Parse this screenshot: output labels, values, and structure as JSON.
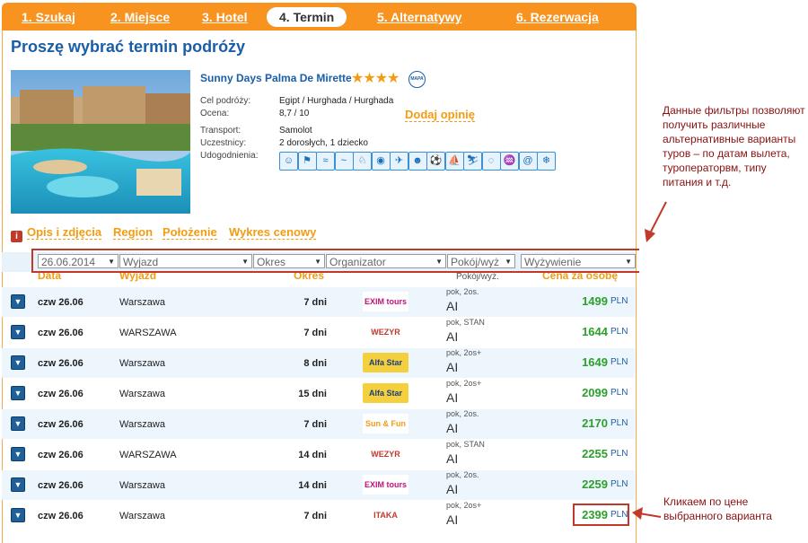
{
  "tabs": [
    "1. Szukaj",
    "2. Miejsce",
    "3. Hotel",
    "4. Termin",
    "5. Alternatywy",
    "6. Rezerwacja"
  ],
  "active_tab": 3,
  "page_title": "Proszę wybrać termin podróży",
  "hotel": {
    "name": "Sunny Days Palma De Mirette",
    "stars": "★★★★",
    "map_label": "MAPA",
    "details": [
      {
        "label": "Cel podróży:",
        "value": "Egipt / Hurghada / Hurghada"
      },
      {
        "label": "Ocena:",
        "value": "8,7 / 10"
      },
      {
        "label": "Transport:",
        "value": "Samolot"
      },
      {
        "label": "Uczestnicy:",
        "value": "2 dorosłych, 1  dziecko"
      },
      {
        "label": "Udogodnienia:",
        "value": ""
      }
    ],
    "add_review": "Dodaj opinię",
    "amenity_icons": [
      "family-icon",
      "tennis-icon",
      "beach-icon",
      "pool-icon",
      "playground-icon",
      "kids-club-icon",
      "plane-icon",
      "animation-icon",
      "sport-icon",
      "windsurf-icon",
      "ski-icon",
      "diving-icon",
      "surf-icon",
      "internet-icon",
      "air-conditioning-icon"
    ]
  },
  "links": [
    "Opis i zdjęcia",
    "Region",
    "Położenie",
    "Wykres cenowy"
  ],
  "filters": {
    "date": "26.06.2014",
    "departure": "Wyjazd",
    "duration": "Okres",
    "organizer": "Organizator",
    "room": "Pokój/wyż",
    "board": "Wyżywienie"
  },
  "columns": {
    "date": "Data",
    "departure": "Wyjazd",
    "duration": "Okres",
    "room": "Pokój/wyż.",
    "price": "Cena za osobę"
  },
  "rows": [
    {
      "date": "czw 26.06",
      "departure": "Warszawa",
      "duration": "7 dni",
      "organizer": "EXIM tours",
      "room": "pok, 2os.",
      "board": "AI",
      "price": "1499",
      "currency": "PLN"
    },
    {
      "date": "czw 26.06",
      "departure": "WARSZAWA",
      "duration": "7 dni",
      "organizer": "WEZYR",
      "room": "pok, STAN",
      "board": "AI",
      "price": "1644",
      "currency": "PLN"
    },
    {
      "date": "czw 26.06",
      "departure": "Warszawa",
      "duration": "8 dni",
      "organizer": "Alfa Star",
      "room": "pok, 2os+",
      "board": "AI",
      "price": "1649",
      "currency": "PLN"
    },
    {
      "date": "czw 26.06",
      "departure": "Warszawa",
      "duration": "15 dni",
      "organizer": "Alfa Star",
      "room": "pok, 2os+",
      "board": "AI",
      "price": "2099",
      "currency": "PLN"
    },
    {
      "date": "czw 26.06",
      "departure": "Warszawa",
      "duration": "7 dni",
      "organizer": "Sun & Fun",
      "room": "pok, 2os.",
      "board": "AI",
      "price": "2170",
      "currency": "PLN"
    },
    {
      "date": "czw 26.06",
      "departure": "WARSZAWA",
      "duration": "14 dni",
      "organizer": "WEZYR",
      "room": "pok, STAN",
      "board": "AI",
      "price": "2255",
      "currency": "PLN"
    },
    {
      "date": "czw 26.06",
      "departure": "Warszawa",
      "duration": "14 dni",
      "organizer": "EXIM tours",
      "room": "pok, 2os.",
      "board": "AI",
      "price": "2259",
      "currency": "PLN"
    },
    {
      "date": "czw 26.06",
      "departure": "Warszawa",
      "duration": "7 dni",
      "organizer": "ITAKA",
      "room": "pok, 2os+",
      "board": "AI",
      "price": "2399",
      "currency": "PLN"
    }
  ],
  "annotations": {
    "filters_note": "Данные фильтры позволяют получить различные альтернативные варианты туров – по датам вылета, туроператорвм, типу питания и т.д.",
    "price_note": "Кликаем по цене выбранного варианта"
  },
  "colors": {
    "accent": "#f7931e",
    "title": "#1a5ea8",
    "price": "#2ca02c",
    "highlight": "#c0392b"
  }
}
